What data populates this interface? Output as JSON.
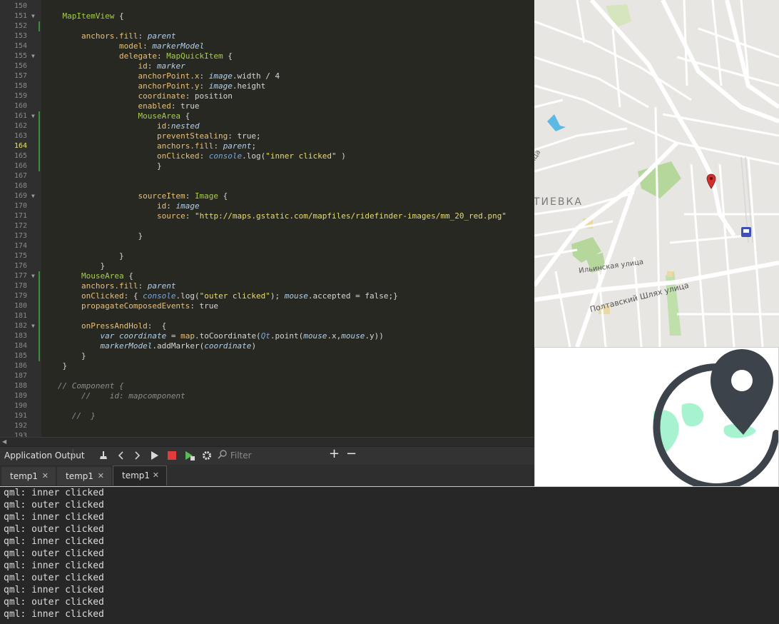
{
  "editor": {
    "current_line": "164",
    "lines": [
      {
        "n": "150",
        "fold": "",
        "mark": false,
        "html": ""
      },
      {
        "n": "151",
        "fold": "▼",
        "mark": false,
        "html": "    <span class='t'>MapItemView</span> {"
      },
      {
        "n": "152",
        "fold": "",
        "mark": true,
        "html": ""
      },
      {
        "n": "153",
        "fold": "",
        "mark": false,
        "html": "        <span class='p'>anchors.fill</span>: <span class='i'>parent</span>"
      },
      {
        "n": "154",
        "fold": "",
        "mark": false,
        "html": "                <span class='p'>model</span>: <span class='i'>markerModel</span>"
      },
      {
        "n": "155",
        "fold": "▼",
        "mark": false,
        "html": "                <span class='p'>delegate</span>: <span class='t'>MapQuickItem</span> {"
      },
      {
        "n": "156",
        "fold": "",
        "mark": false,
        "html": "                    <span class='p'>id</span>: <span class='i'>marker</span>"
      },
      {
        "n": "157",
        "fold": "",
        "mark": false,
        "html": "                    <span class='p'>anchorPoint.x</span>: <span class='i'>image</span>.width / 4"
      },
      {
        "n": "158",
        "fold": "",
        "mark": false,
        "html": "                    <span class='p'>anchorPoint.y</span>: <span class='i'>image</span>.height"
      },
      {
        "n": "159",
        "fold": "",
        "mark": false,
        "html": "                    <span class='p'>coordinate</span>: position"
      },
      {
        "n": "160",
        "fold": "",
        "mark": false,
        "html": "                    <span class='p'>enabled</span>: true"
      },
      {
        "n": "161",
        "fold": "▼",
        "mark": true,
        "html": "                    <span class='t'>MouseArea</span> {"
      },
      {
        "n": "162",
        "fold": "",
        "mark": true,
        "html": "                        <span class='p'>id</span>:<span class='i'>nested</span>"
      },
      {
        "n": "163",
        "fold": "",
        "mark": true,
        "html": "                        <span class='p'>preventStealing</span>: true;"
      },
      {
        "n": "164",
        "fold": "",
        "mark": true,
        "html": "                        <span class='p'>anchors.fill</span>: <span class='i'>parent</span>;"
      },
      {
        "n": "165",
        "fold": "",
        "mark": true,
        "html": "                        <span class='p'>onClicked</span>: <span class='b'>console</span>.log(<span class='s'>\"inner clicked\"</span> )"
      },
      {
        "n": "166",
        "fold": "",
        "mark": true,
        "html": "                        }"
      },
      {
        "n": "167",
        "fold": "",
        "mark": false,
        "html": ""
      },
      {
        "n": "168",
        "fold": "",
        "mark": false,
        "html": ""
      },
      {
        "n": "169",
        "fold": "▼",
        "mark": false,
        "html": "                    <span class='p'>sourceItem</span>: <span class='t'>Image</span> {"
      },
      {
        "n": "170",
        "fold": "",
        "mark": false,
        "html": "                        <span class='p'>id</span>: <span class='i'>image</span>"
      },
      {
        "n": "171",
        "fold": "",
        "mark": false,
        "html": "                        <span class='p'>source</span>: <span class='s'>\"http://maps.gstatic.com/mapfiles/ridefinder-images/mm_20_red.png\"</span>"
      },
      {
        "n": "172",
        "fold": "",
        "mark": false,
        "html": ""
      },
      {
        "n": "173",
        "fold": "",
        "mark": false,
        "html": "                    }"
      },
      {
        "n": "174",
        "fold": "",
        "mark": false,
        "html": ""
      },
      {
        "n": "175",
        "fold": "",
        "mark": false,
        "html": "                }"
      },
      {
        "n": "176",
        "fold": "",
        "mark": false,
        "html": "            }"
      },
      {
        "n": "177",
        "fold": "▼",
        "mark": true,
        "html": "        <span class='t'>MouseArea</span> {"
      },
      {
        "n": "178",
        "fold": "",
        "mark": true,
        "html": "        <span class='p'>anchors.fill</span>: <span class='i'>parent</span>"
      },
      {
        "n": "179",
        "fold": "",
        "mark": true,
        "html": "        <span class='p'>onClicked</span>: { <span class='b'>console</span>.log(<span class='s'>\"outer clicked\"</span>); <span class='i'>mouse</span>.accepted = false;}"
      },
      {
        "n": "180",
        "fold": "",
        "mark": true,
        "html": "        <span class='p'>propagateComposedEvents</span>: true"
      },
      {
        "n": "181",
        "fold": "",
        "mark": true,
        "html": ""
      },
      {
        "n": "182",
        "fold": "▼",
        "mark": true,
        "html": "        <span class='p'>onPressAndHold</span>:  {"
      },
      {
        "n": "183",
        "fold": "",
        "mark": true,
        "html": "            <span class='i'>var</span> <span class='i'>coordinate</span> = <span class='p'>map</span>.toCoordinate(<span class='b'>Qt</span>.point(<span class='i'>mouse</span>.x,<span class='i'>mouse</span>.y))"
      },
      {
        "n": "184",
        "fold": "",
        "mark": true,
        "html": "            <span class='i'>markerModel</span>.addMarker(<span class='i'>coordinate</span>)"
      },
      {
        "n": "185",
        "fold": "",
        "mark": true,
        "html": "        }"
      },
      {
        "n": "186",
        "fold": "",
        "mark": false,
        "html": "    }"
      },
      {
        "n": "187",
        "fold": "",
        "mark": false,
        "html": ""
      },
      {
        "n": "188",
        "fold": "",
        "mark": false,
        "html": "   <span class='c'>// Component {</span>"
      },
      {
        "n": "189",
        "fold": "",
        "mark": false,
        "html": "        <span class='c'>//    id: mapcomponent</span>"
      },
      {
        "n": "190",
        "fold": "",
        "mark": false,
        "html": ""
      },
      {
        "n": "191",
        "fold": "",
        "mark": false,
        "html": "      <span class='c'>//  }</span>"
      },
      {
        "n": "192",
        "fold": "",
        "mark": false,
        "html": ""
      },
      {
        "n": "193",
        "fold": "",
        "mark": false,
        "html": ""
      }
    ]
  },
  "output_pane": {
    "title": "Application Output",
    "filter_placeholder": "Filter",
    "tabs": [
      {
        "label": "temp1",
        "active": false
      },
      {
        "label": "temp1",
        "active": false
      },
      {
        "label": "temp1",
        "active": true
      }
    ],
    "lines": [
      "qml: inner clicked",
      "qml: outer clicked",
      "qml: inner clicked",
      "qml: outer clicked",
      "qml: inner clicked",
      "qml: outer clicked",
      "qml: inner clicked",
      "qml: outer clicked",
      "qml: inner clicked",
      "qml: outer clicked",
      "qml: inner clicked"
    ]
  },
  "map": {
    "district_label": "ТИЕВКА",
    "street_1": "Ильинская улица",
    "street_2": "Полтавский Шлях улица",
    "edge_label": "ица",
    "marker_color": "#d32f2f"
  },
  "colors": {
    "stop_red": "#e03c3c",
    "run_green": "#5bb85b",
    "logo_dark": "#3d434a",
    "logo_mint": "#a7f3d0"
  }
}
